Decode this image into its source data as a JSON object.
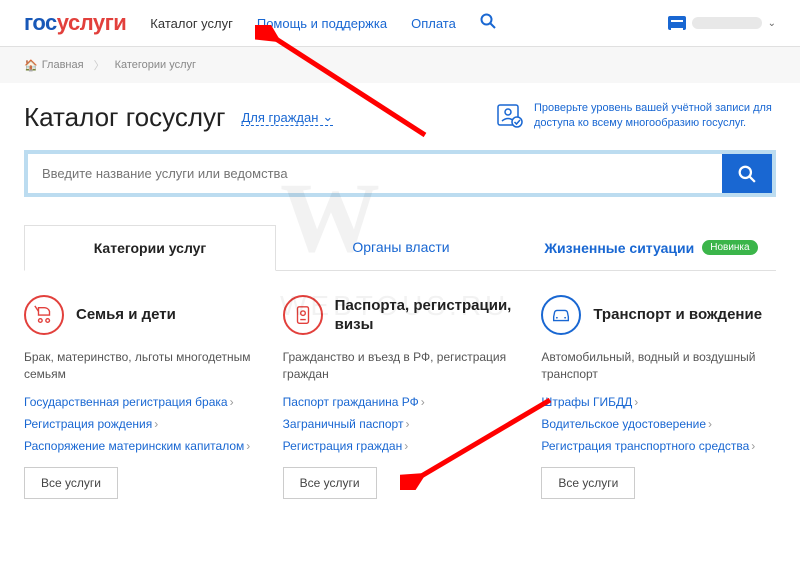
{
  "logo": {
    "part1": "гос",
    "part2": "услуги"
  },
  "nav": {
    "catalog": "Каталог услуг",
    "help": "Помощь и поддержка",
    "payment": "Оплата"
  },
  "breadcrumb": {
    "home": "Главная",
    "current": "Категории услуг"
  },
  "page": {
    "title": "Каталог госуслуг",
    "filter": "Для граждан"
  },
  "verify": {
    "text": "Проверьте уровень вашей учётной записи для доступа ко всему многообразию госуслуг."
  },
  "search": {
    "placeholder": "Введите название услуги или ведомства"
  },
  "tabs": {
    "categories": "Категории услуг",
    "authorities": "Органы власти",
    "situations": "Жизненные ситуации",
    "badge": "Новинка"
  },
  "categories": [
    {
      "title": "Семья и дети",
      "desc": "Брак, материнство, льготы многодетным семьям",
      "links": [
        "Государственная регистрация брака",
        "Регистрация рождения",
        "Распоряжение материнским капиталом"
      ]
    },
    {
      "title": "Паспорта, регистрации, визы",
      "desc": "Гражданство и въезд в РФ, регистрация граждан",
      "links": [
        "Паспорт гражданина РФ",
        "Заграничный паспорт",
        "Регистрация граждан"
      ]
    },
    {
      "title": "Транспорт и вождение",
      "desc": "Автомобильный, водный и воздушный транспорт",
      "links": [
        "Штрафы ГИБДД",
        "Водительское удостоверение",
        "Регистрация транспортного средства"
      ]
    }
  ],
  "buttons": {
    "all": "Все услуги"
  }
}
